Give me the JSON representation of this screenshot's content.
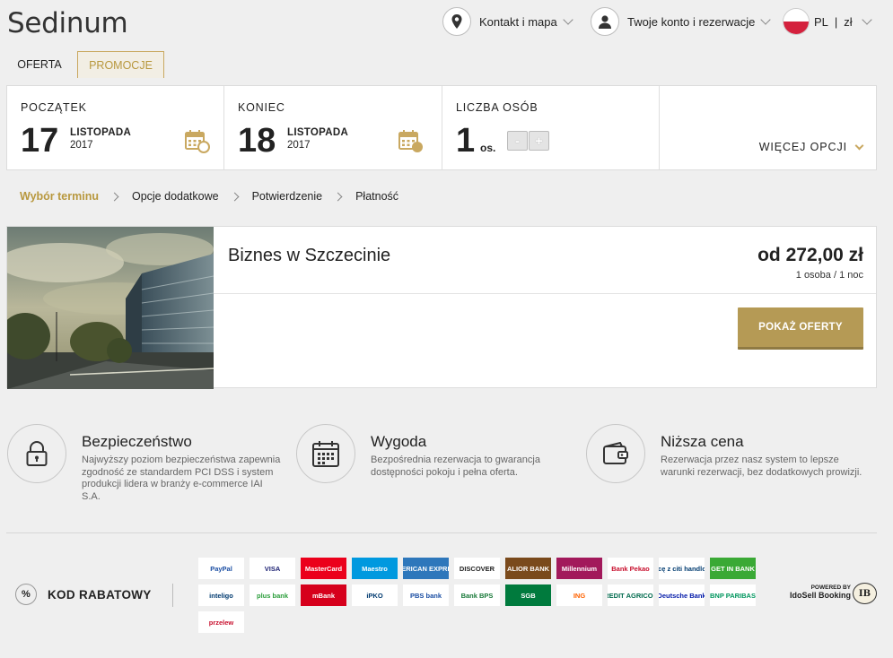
{
  "header": {
    "logo": "Sedinum",
    "contact": "Kontakt i mapa",
    "account": "Twoje konto i rezerwacje",
    "lang": "PL",
    "sep": "|",
    "currency": "zł"
  },
  "tabs": [
    {
      "label": "OFERTA"
    },
    {
      "label": "PROMOCJE"
    }
  ],
  "search": {
    "start": {
      "label": "POCZĄTEK",
      "day": "17",
      "month": "LISTOPADA",
      "year": "2017"
    },
    "end": {
      "label": "KONIEC",
      "day": "18",
      "month": "LISTOPADA",
      "year": "2017"
    },
    "guests": {
      "label": "LICZBA OSÓB",
      "count": "1",
      "unit": "os.",
      "minus": "-",
      "plus": "+"
    },
    "more": "WIĘCEJ OPCJI"
  },
  "breadcrumb": [
    "Wybór terminu",
    "Opcje dodatkowe",
    "Potwierdzenie",
    "Płatność"
  ],
  "offer": {
    "title": "Biznes w Szczecinie",
    "price": "od 272,00 zł",
    "price_note": "1 osoba / 1 noc",
    "button": "POKAŻ OFERTY"
  },
  "features": [
    {
      "icon": "lock-icon",
      "title": "Bezpieczeństwo",
      "text": "Najwyższy poziom bezpieczeństwa zapewnia zgodność ze standardem PCI DSS i system produkcji lidera w branży e-commerce IAI S.A."
    },
    {
      "icon": "calendar-icon",
      "title": "Wygoda",
      "text": "Bezpośrednia rezerwacja to gwarancja dostępności pokoju i pełna oferta."
    },
    {
      "icon": "wallet-icon",
      "title": "Niższa cena",
      "text": "Rezerwacja przez nasz system to lepsze warunki rezerwacji, bez dodatkowych prowizji."
    }
  ],
  "discount": {
    "icon_text": "%",
    "label": "KOD RABATOWY"
  },
  "payments": [
    {
      "text": "PayPal",
      "color": "#1b4ea3",
      "bg": "#ffffff"
    },
    {
      "text": "VISA",
      "color": "#1a1f71",
      "bg": "#ffffff"
    },
    {
      "text": "MasterCard",
      "color": "#ffffff",
      "bg": "#eb001b"
    },
    {
      "text": "Maestro",
      "color": "#ffffff",
      "bg": "#0099df"
    },
    {
      "text": "AMERICAN EXPRESS",
      "color": "#ffffff",
      "bg": "#2e77bb"
    },
    {
      "text": "DISCOVER",
      "color": "#222222",
      "bg": "#ffffff"
    },
    {
      "text": "ALIOR BANK",
      "color": "#ffffff",
      "bg": "#7a4a1c"
    },
    {
      "text": "Millennium",
      "color": "#ffffff",
      "bg": "#a2195b"
    },
    {
      "text": "Bank Pekao",
      "color": "#c8102e",
      "bg": "#ffffff"
    },
    {
      "text": "płacę z citi handlowy",
      "color": "#003b70",
      "bg": "#ffffff"
    },
    {
      "text": "GET IN BANK",
      "color": "#ffffff",
      "bg": "#3aa935"
    },
    {
      "text": "inteligo",
      "color": "#003a70",
      "bg": "#ffffff"
    },
    {
      "text": "plus bank",
      "color": "#2a9d3a",
      "bg": "#ffffff"
    },
    {
      "text": "mBank",
      "color": "#ffffff",
      "bg": "#d6001c"
    },
    {
      "text": "iPKO",
      "color": "#003a70",
      "bg": "#ffffff"
    },
    {
      "text": "PBS bank",
      "color": "#1b4ea3",
      "bg": "#ffffff"
    },
    {
      "text": "Bank BPS",
      "color": "#1a7a3a",
      "bg": "#ffffff"
    },
    {
      "text": "SGB",
      "color": "#ffffff",
      "bg": "#007a3d"
    },
    {
      "text": "ING",
      "color": "#ff6200",
      "bg": "#ffffff"
    },
    {
      "text": "CREDIT AGRICOLE",
      "color": "#006a4d",
      "bg": "#ffffff"
    },
    {
      "text": "Deutsche Bank",
      "color": "#0018a8",
      "bg": "#ffffff"
    },
    {
      "text": "BNP PARIBAS",
      "color": "#00965e",
      "bg": "#ffffff"
    },
    {
      "text": "przelew",
      "color": "#c8102e",
      "bg": "#ffffff"
    }
  ],
  "powered": {
    "line1": "POWERED BY",
    "line2": "IdoSell Booking",
    "seal": "IB"
  }
}
